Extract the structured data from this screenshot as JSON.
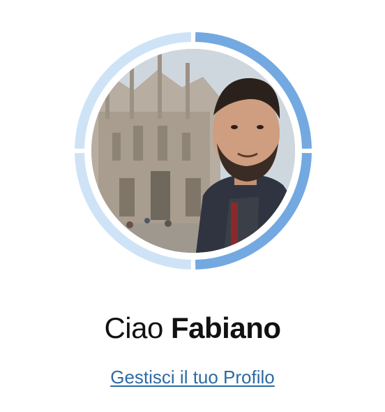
{
  "greeting": {
    "prefix": "Ciao",
    "name": "Fabiano"
  },
  "profile_link": {
    "label": "Gestisci il tuo Profilo"
  },
  "progress_ring": {
    "segments": 4,
    "completed_segments": 2,
    "colors": {
      "completed": "#73a9e0",
      "remaining": "#cfe3f7"
    }
  },
  "avatar": {
    "icon": "user-photo"
  }
}
